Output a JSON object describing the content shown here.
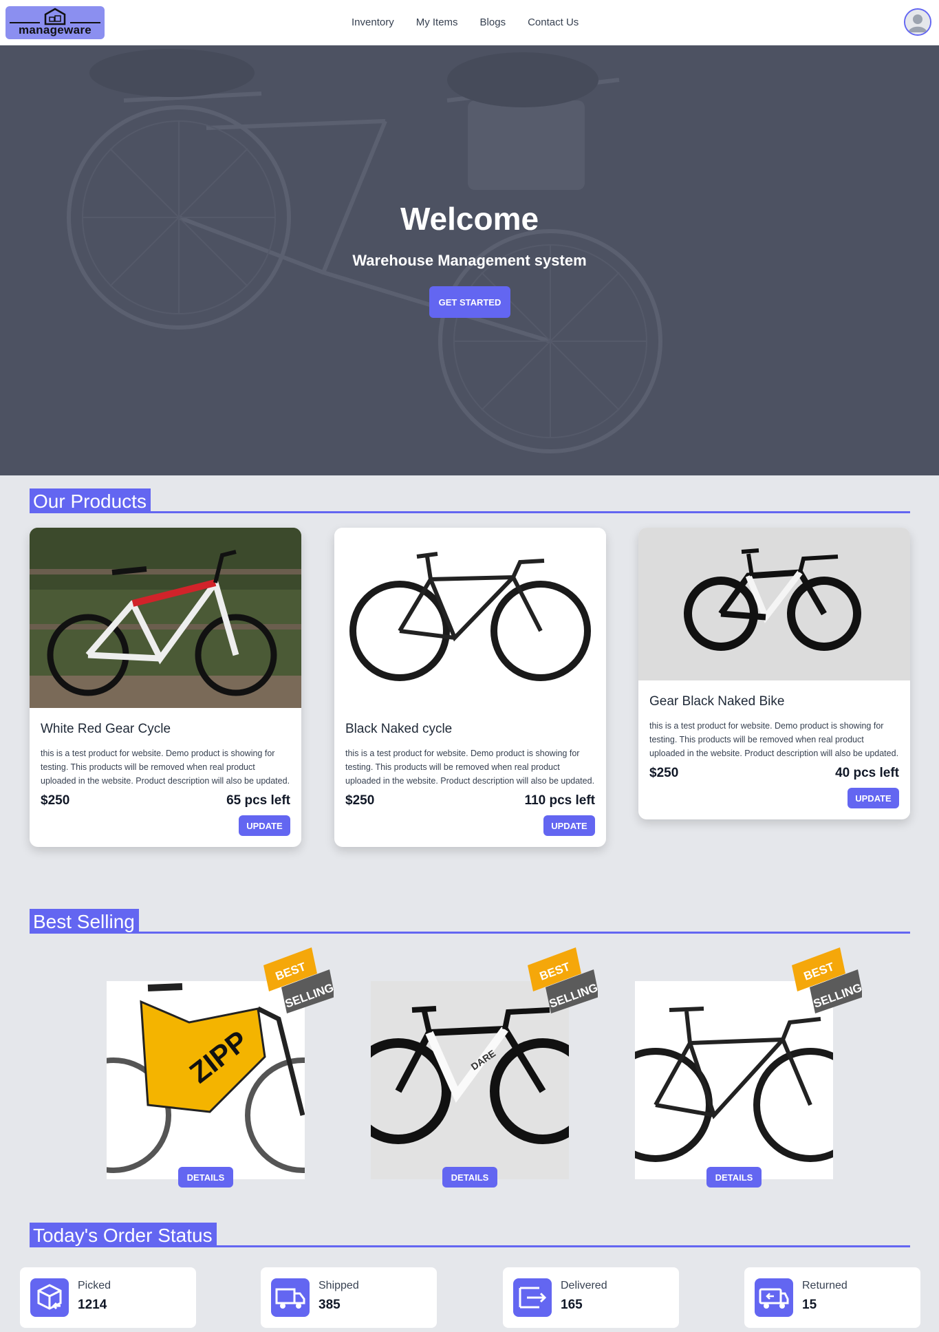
{
  "brand": {
    "name": "manageware"
  },
  "nav": {
    "items": [
      "Inventory",
      "My Items",
      "Blogs",
      "Contact Us"
    ]
  },
  "hero": {
    "title": "Welcome",
    "subtitle": "Warehouse Management system",
    "cta": "GET STARTED"
  },
  "sections": {
    "products": "Our Products",
    "best_selling": "Best Selling",
    "orders": "Today's Order Status"
  },
  "products": [
    {
      "name": "White Red Gear Cycle",
      "description": "this is a test product for website. Demo product is showing for testing. This products will be removed when real product uploaded in the website. Product description will also be updated.",
      "price": "$250",
      "stock": "65 pcs left",
      "button": "UPDATE"
    },
    {
      "name": "Black Naked cycle",
      "description": "this is a test product for website. Demo product is showing for testing. This products will be removed when real product uploaded in the website. Product description will also be updated.",
      "price": "$250",
      "stock": "110 pcs left",
      "button": "UPDATE"
    },
    {
      "name": "Gear Black Naked Bike",
      "description": "this is a test product for website. Demo product is showing for testing. This products will be removed when real product uploaded in the website. Product description will also be updated.",
      "price": "$250",
      "stock": "40 pcs left",
      "button": "UPDATE"
    }
  ],
  "best_selling": {
    "ribbon": {
      "line1": "BEST",
      "line2": "SELLING"
    },
    "button": "DETAILS",
    "items": [
      {
        "photo_text": "ZIPP"
      },
      {
        "photo_text": "DARE"
      },
      {
        "photo_text": ""
      }
    ]
  },
  "order_status": [
    {
      "label": "Picked",
      "value": "1214",
      "icon": "box-return-icon"
    },
    {
      "label": "Shipped",
      "value": "385",
      "icon": "truck-icon"
    },
    {
      "label": "Delivered",
      "value": "165",
      "icon": "delivered-icon"
    },
    {
      "label": "Returned",
      "value": "15",
      "icon": "return-truck-icon"
    }
  ],
  "colors": {
    "accent": "#6366f1",
    "ribbon": "#f5a70a",
    "ribbon_dark": "#5b5b5b",
    "background": "#e5e7eb"
  }
}
